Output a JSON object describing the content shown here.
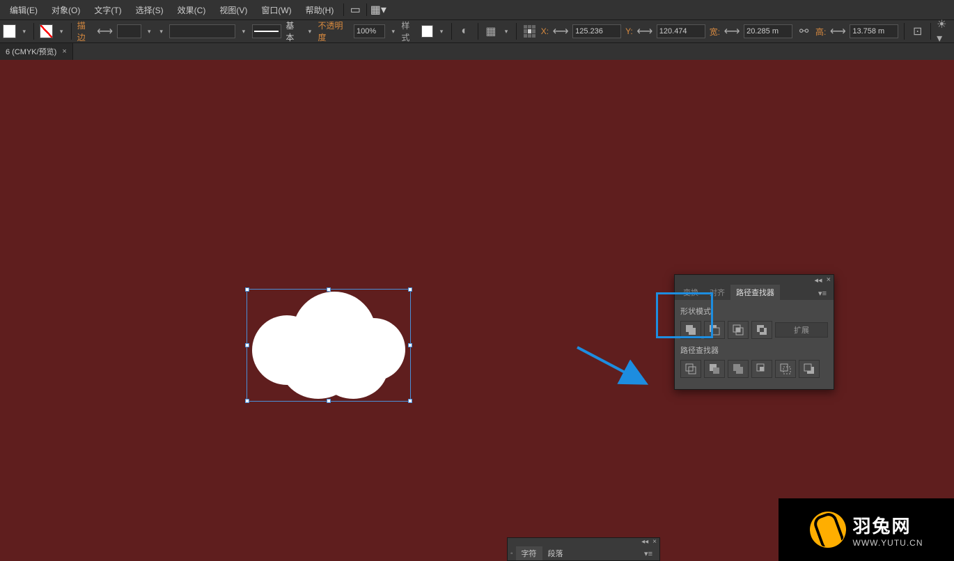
{
  "menubar": {
    "items": [
      "编辑(E)",
      "对象(O)",
      "文字(T)",
      "选择(S)",
      "效果(C)",
      "视图(V)",
      "窗口(W)",
      "帮助(H)"
    ]
  },
  "optionsbar": {
    "stroke_label": "描边",
    "type_label": "基本",
    "opacity_label": "不透明度",
    "opacity_value": "100%",
    "style_label": "样式",
    "x_label": "X:",
    "x_value": "125.236",
    "y_label": "Y:",
    "y_value": "120.474",
    "w_label": "宽:",
    "w_value": "20.285 m",
    "h_label": "高:",
    "h_value": "13.758 m"
  },
  "doctab": {
    "title": "6 (CMYK/预览)"
  },
  "pathfinder_panel": {
    "tabs": [
      "变换",
      "对齐",
      "路径查找器"
    ],
    "active_tab": 2,
    "shape_modes_label": "形状模式",
    "pathfinders_label": "路径查找器",
    "expand_label": "扩展"
  },
  "char_panel": {
    "tabs": [
      "字符",
      "段落"
    ]
  },
  "watermark": {
    "title": "羽兔网",
    "url": "WWW.YUTU.CN"
  }
}
